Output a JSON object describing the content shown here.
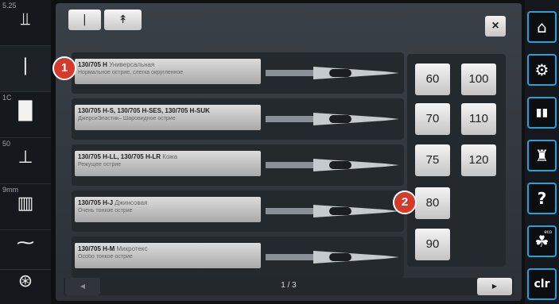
{
  "sidebar_left": {
    "items": [
      {
        "num": "5.25",
        "icon": "stitch-width-icon",
        "glyph": "⫫"
      },
      {
        "num": "",
        "icon": "needle-icon",
        "glyph": "❘"
      },
      {
        "num": "1C",
        "icon": "presser-foot-icon",
        "glyph": "█"
      },
      {
        "num": "50",
        "icon": "foot-pressure-icon",
        "glyph": "⊥"
      },
      {
        "num": "9mm",
        "icon": "stitch-plate-icon",
        "glyph": "▥"
      },
      {
        "num": "",
        "icon": "stitch-pattern-icon",
        "glyph": "⁓"
      },
      {
        "num": "",
        "icon": "bobbin-icon",
        "glyph": "⊛"
      }
    ]
  },
  "breadcrumb": {
    "items": [
      "|",
      "↟"
    ]
  },
  "close_label": "×",
  "needles": [
    {
      "code": "130/705 H",
      "name": "Универсальная",
      "desc": "Нормальное острие, слегка округленное"
    },
    {
      "code": "130/705 H-S, 130/705 H-SES, 130/705 H-SUK",
      "name": "",
      "desc": "ДжерсиЭластик– Шаровидное острие"
    },
    {
      "code": "130/705 H-LL, 130/705 H-LR",
      "name": "Кожа",
      "desc": "Режущее острие"
    },
    {
      "code": "130/705 H-J",
      "name": "Джинсовая",
      "desc": "Очень тонкое острие"
    },
    {
      "code": "130/705 H-M",
      "name": "Микротекс",
      "desc": "Особо тонкое острие"
    }
  ],
  "sizes": {
    "left": [
      "60",
      "70",
      "75",
      "80",
      "90"
    ],
    "right": [
      "100",
      "110",
      "120"
    ]
  },
  "footer": {
    "page": "1 / 3",
    "prev": "◀",
    "next": "▶"
  },
  "markers": [
    "1",
    "2"
  ],
  "sidebar_right": {
    "items": [
      {
        "icon": "home-icon",
        "glyph": "⌂"
      },
      {
        "icon": "settings-icon",
        "glyph": "⚙"
      },
      {
        "icon": "book-icon",
        "glyph": "▮▮"
      },
      {
        "icon": "mannequin-icon",
        "glyph": "♜"
      },
      {
        "icon": "help-icon",
        "glyph": "?"
      },
      {
        "icon": "eco-icon",
        "glyph": "☘",
        "badge": "eco"
      },
      {
        "icon": "clear-icon",
        "glyph": "clr"
      }
    ]
  },
  "colors": {
    "marker": "#d63a2a",
    "accent_border": "#2a9fd8"
  }
}
